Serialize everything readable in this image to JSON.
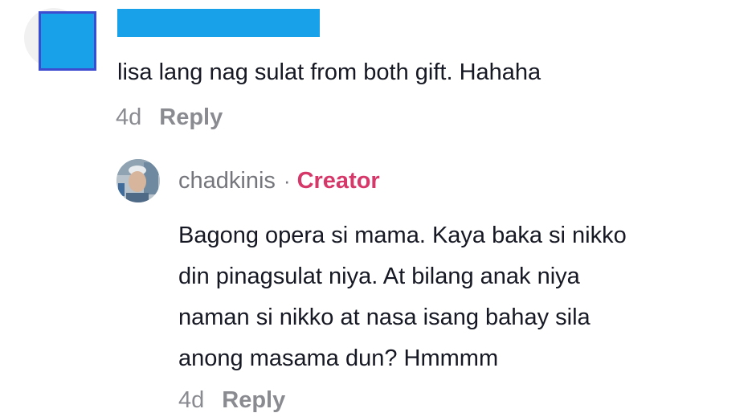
{
  "comment": {
    "text": "lisa lang nag sulat from both gift. Hahaha",
    "age": "4d",
    "reply_label": "Reply",
    "redaction_color": "#18a0e8"
  },
  "reply": {
    "username": "chadkinis",
    "separator": "·",
    "badge": "Creator",
    "badge_color": "#d6386a",
    "lines": [
      "Bagong opera si mama. Kaya baka si nikko",
      "din pinagsulat niya. At bilang anak niya",
      "naman si nikko at nasa isang bahay sila",
      "anong masama dun? Hmmmm"
    ],
    "age": "4d",
    "reply_label": "Reply"
  }
}
